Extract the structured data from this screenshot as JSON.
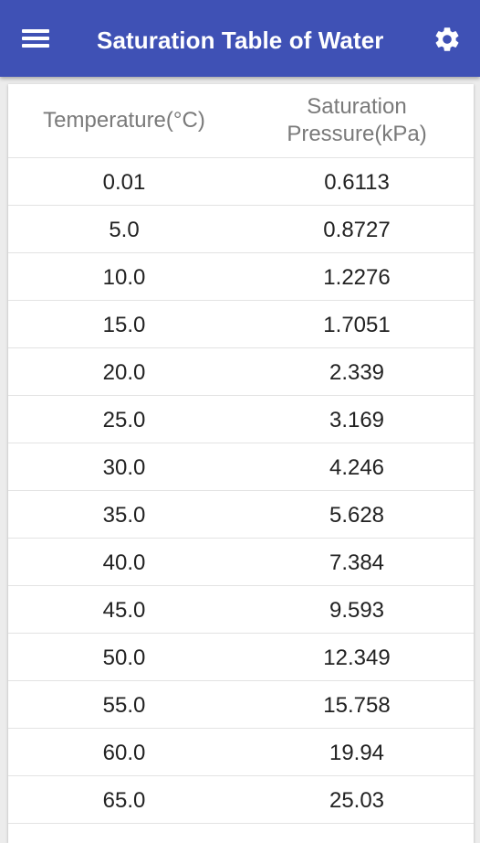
{
  "app_bar": {
    "title": "Saturation Table of Water",
    "menu_icon": "hamburger-menu-icon",
    "settings_icon": "gear-icon",
    "color": "#3f51b5"
  },
  "table": {
    "headers": {
      "temperature": "Temperature(°C)",
      "pressure_line1": "Saturation",
      "pressure_line2": "Pressure(kPa)"
    },
    "rows": [
      {
        "temperature": "0.01",
        "pressure": "0.6113"
      },
      {
        "temperature": "5.0",
        "pressure": "0.8727"
      },
      {
        "temperature": "10.0",
        "pressure": "1.2276"
      },
      {
        "temperature": "15.0",
        "pressure": "1.7051"
      },
      {
        "temperature": "20.0",
        "pressure": "2.339"
      },
      {
        "temperature": "25.0",
        "pressure": "3.169"
      },
      {
        "temperature": "30.0",
        "pressure": "4.246"
      },
      {
        "temperature": "35.0",
        "pressure": "5.628"
      },
      {
        "temperature": "40.0",
        "pressure": "7.384"
      },
      {
        "temperature": "45.0",
        "pressure": "9.593"
      },
      {
        "temperature": "50.0",
        "pressure": "12.349"
      },
      {
        "temperature": "55.0",
        "pressure": "15.758"
      },
      {
        "temperature": "60.0",
        "pressure": "19.94"
      },
      {
        "temperature": "65.0",
        "pressure": "25.03"
      }
    ]
  }
}
